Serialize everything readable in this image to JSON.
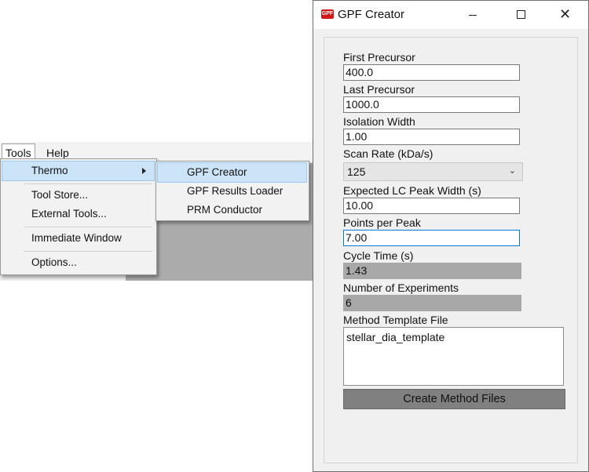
{
  "host": {
    "menubar": {
      "tools": "Tools",
      "help": "Help"
    },
    "tools_menu": {
      "items": [
        {
          "label": "Thermo"
        },
        {
          "label": "Tool Store..."
        },
        {
          "label": "External Tools..."
        },
        {
          "label": "Immediate Window"
        },
        {
          "label": "Options..."
        }
      ]
    },
    "thermo_menu": {
      "items": [
        {
          "label": "GPF Creator"
        },
        {
          "label": "GPF Results Loader"
        },
        {
          "label": "PRM Conductor"
        }
      ]
    }
  },
  "gpf_window": {
    "title": "GPF Creator",
    "icon_text": "GPF",
    "fields": {
      "first_precursor": {
        "label": "First Precursor",
        "value": "400.0"
      },
      "last_precursor": {
        "label": "Last Precursor",
        "value": "1000.0"
      },
      "isolation_width": {
        "label": "Isolation Width",
        "value": "1.00"
      },
      "scan_rate": {
        "label": "Scan Rate (kDa/s)",
        "value": "125"
      },
      "lc_peak_width": {
        "label": "Expected LC Peak Width (s)",
        "value": "10.00"
      },
      "points_per_peak": {
        "label": "Points per Peak",
        "value": "7.00"
      },
      "cycle_time": {
        "label": "Cycle Time (s)",
        "value": "1.43"
      },
      "num_experiments": {
        "label": "Number of Experiments",
        "value": "6"
      },
      "method_template": {
        "label": "Method Template File",
        "value": "stellar_dia_template"
      }
    },
    "create_button": "Create Method Files",
    "icons": {
      "close": "✕"
    }
  }
}
